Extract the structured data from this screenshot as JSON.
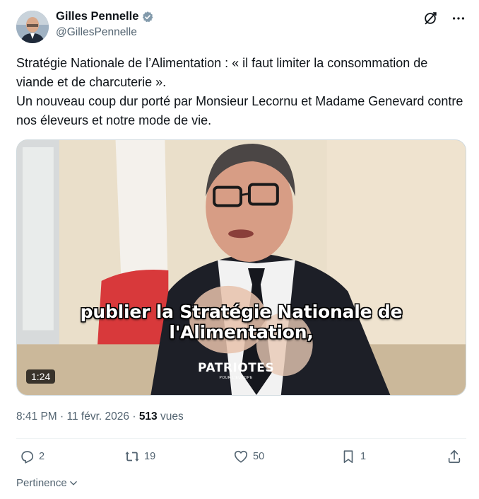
{
  "author": {
    "name": "Gilles Pennelle",
    "handle": "@GillesPennelle",
    "verified_color": "#829aab"
  },
  "header_icons": [
    "grok-icon",
    "more-icon"
  ],
  "tweet": {
    "line1": "Stratégie Nationale de l’Alimentation : « il faut limiter la consommation de viande et de charcuterie ».",
    "line2": "Un nouveau coup dur porté par Monsieur Lecornu et Madame Genevard contre nos éleveurs et notre mode de vie."
  },
  "video": {
    "subtitle": "publier la Stratégie Nationale de l'Alimentation,",
    "watermark": "PATRIOTES",
    "watermark_sub": "POUR L'EUROPE",
    "duration": "1:24"
  },
  "meta": {
    "time": "8:41 PM",
    "separator": "·",
    "date": "11 févr. 2026",
    "views": "513",
    "views_label": "vues"
  },
  "actions": {
    "replies": "2",
    "reposts": "19",
    "likes": "50",
    "bookmarks": "1"
  },
  "sort": {
    "label": "Pertinence"
  },
  "colors": {
    "text": "#0f1419",
    "muted": "#536471",
    "divider": "#eff3f4"
  }
}
